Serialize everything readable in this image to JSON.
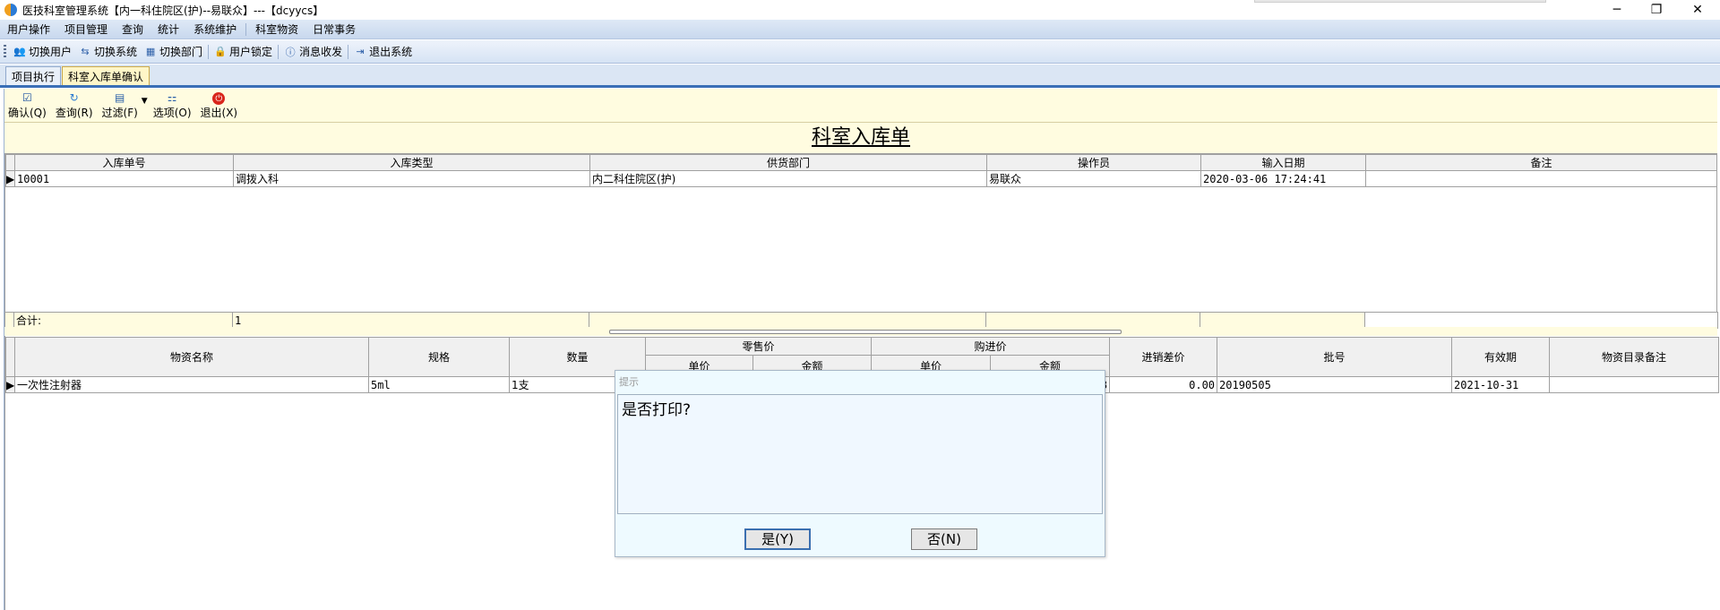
{
  "window": {
    "title": "医技科室管理系统【内一科住院区(护)--易联众】---【dcyycs】",
    "controls": {
      "minimize": "─",
      "restore": "❐",
      "close": "✕"
    }
  },
  "menu": [
    "用户操作",
    "项目管理",
    "查询",
    "统计",
    "系统维护",
    "科室物资",
    "日常事务"
  ],
  "toolbar": [
    {
      "label": "切换用户",
      "icon": "users-icon"
    },
    {
      "label": "切换系统",
      "icon": "switch-system-icon"
    },
    {
      "label": "切换部门",
      "icon": "department-icon"
    },
    {
      "label": "用户锁定",
      "icon": "lock-user-icon"
    },
    {
      "label": "消息收发",
      "icon": "message-icon"
    },
    {
      "label": "退出系统",
      "icon": "exit-icon"
    }
  ],
  "tabs": [
    {
      "label": "项目执行",
      "active": false
    },
    {
      "label": "科室入库单确认",
      "active": true
    }
  ],
  "actions": [
    {
      "label": "确认(Q)",
      "icon": "check-icon"
    },
    {
      "label": "查询(R)",
      "icon": "refresh-icon"
    },
    {
      "label": "过滤(F)",
      "icon": "filter-icon"
    },
    {
      "label": "选项(O)",
      "icon": "options-icon"
    },
    {
      "label": "退出(X)",
      "icon": "power-icon"
    }
  ],
  "form_title": "科室入库单",
  "upper_table": {
    "columns": [
      "入库单号",
      "入库类型",
      "供货部门",
      "操作员",
      "输入日期",
      "备注"
    ],
    "rows": [
      [
        "10001",
        "调拨入科",
        "内二科住院区(护)",
        "易联众",
        "2020-03-06 17:24:41",
        ""
      ]
    ],
    "total_label": "合计:",
    "total_value": "1"
  },
  "lower_table": {
    "columns": {
      "name": "物资名称",
      "spec": "规格",
      "qty": "数量",
      "retail_group": "零售价",
      "retail_unit": "单价",
      "retail_amount": "金额",
      "purchase_group": "购进价",
      "purchase_unit": "单价",
      "purchase_amount": "金额",
      "diff": "进销差价",
      "batch": "批号",
      "expiry": "有效期",
      "catalog_note": "物资目录备注"
    },
    "rows": [
      {
        "name": "一次性注射器",
        "spec": "5ml",
        "qty": "1支",
        "diff": "0.00",
        "batch": "20190505",
        "expiry": "2021-10-31",
        "catalog_note": ""
      }
    ],
    "partial_cell": "8"
  },
  "dialog": {
    "title": "提示",
    "message": "是否打印?",
    "yes_label": "是(Y)",
    "no_label": "否(N)"
  }
}
